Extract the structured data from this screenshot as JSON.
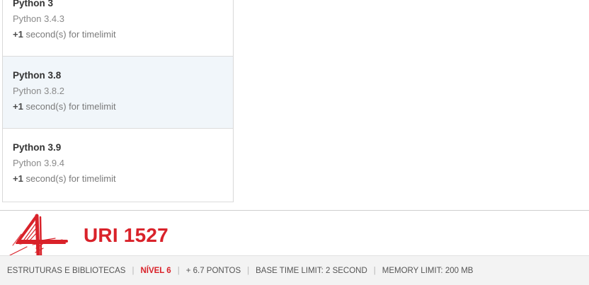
{
  "languages": [
    {
      "name": "Python 3",
      "version": "Python 3.4.3",
      "extra_prefix": "+1",
      "extra_suffix": " second(s) for timelimit",
      "active": false
    },
    {
      "name": "Python 3.8",
      "version": "Python 3.8.2",
      "extra_prefix": "+1",
      "extra_suffix": " second(s) for timelimit",
      "active": true
    },
    {
      "name": "Python 3.9",
      "version": "Python 3.9.4",
      "extra_prefix": "+1",
      "extra_suffix": " second(s) for timelimit",
      "active": false
    }
  ],
  "problem": {
    "logo_icon": "hand-drawn-4-logo-icon",
    "title": "URI 1527"
  },
  "info_bar": {
    "category": "ESTRUTURAS E BIBLIOTECAS",
    "level": "NÍVEL 6",
    "points": "+ 6.7 PONTOS",
    "time_limit": "BASE TIME LIMIT: 2 SECOND",
    "memory_limit": "MEMORY LIMIT: 200 MB",
    "separator": "|"
  },
  "colors": {
    "accent_red": "#d9222a",
    "active_row_bg": "#f1f6fa"
  }
}
